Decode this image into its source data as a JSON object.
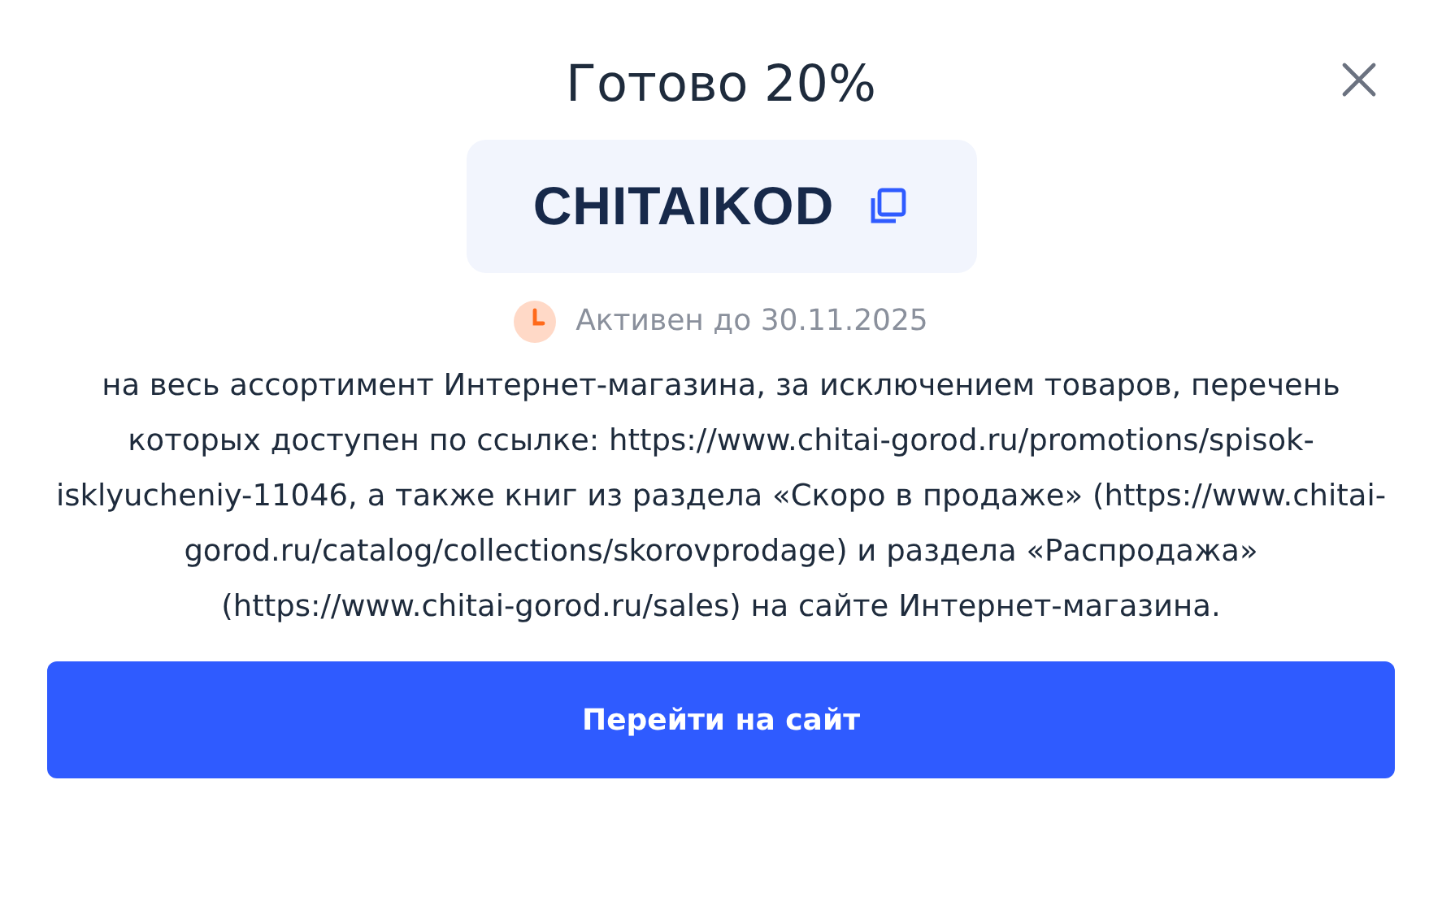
{
  "title": "Готово 20%",
  "promo_code": "CHITAIKOD",
  "validity": "Активен до 30.11.2025",
  "description": "на весь ассортимент Интернет-магазина, за исключением товаров, перечень которых доступен по ссылке: https://www.chitai-gorod.ru/promotions/spisok-isklyucheniy-11046, а также книг из раздела «Скоро в продаже» (https://www.chitai-gorod.ru/catalog/collections/skorovprodage) и раздела «Распродажа» (https://www.chitai-gorod.ru/sales) на сайте Интернет-магазина.",
  "button": "Перейти на сайт"
}
